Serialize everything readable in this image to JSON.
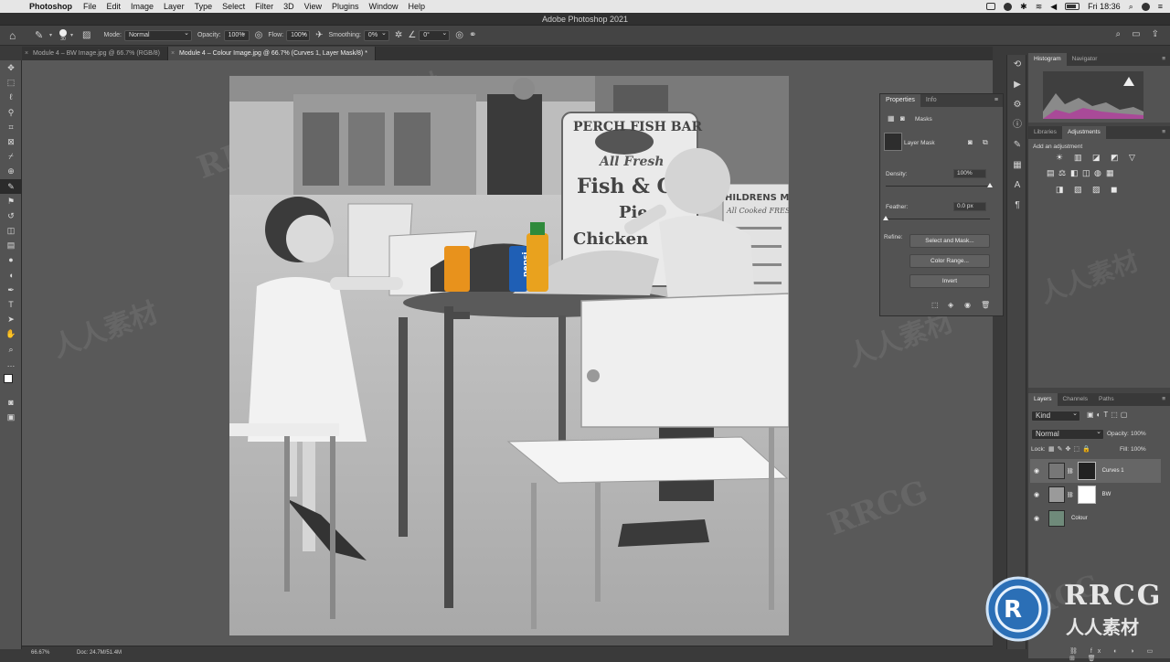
{
  "menubar": {
    "app": "Photoshop",
    "items": [
      "File",
      "Edit",
      "Image",
      "Layer",
      "Type",
      "Select",
      "Filter",
      "3D",
      "View",
      "Plugins",
      "Window",
      "Help"
    ],
    "clock": "Fri 18:36"
  },
  "window_title": "Adobe Photoshop 2021",
  "options": {
    "brush_size": "30",
    "mode_label": "Mode:",
    "mode_value": "Normal",
    "opacity_label": "Opacity:",
    "opacity_value": "100%",
    "flow_label": "Flow:",
    "flow_value": "100%",
    "smoothing_label": "Smoothing:",
    "smoothing_value": "0%",
    "angle_value": "0°"
  },
  "tabs": [
    {
      "label": "Module 4 – BW Image.jpg @ 66.7% (RGB/8)"
    },
    {
      "label": "Module 4 – Colour Image.jpg @ 66.7% (Curves 1, Layer Mask/8) *"
    }
  ],
  "photo_text": {
    "sign_title": "PERCH FISH BAR",
    "sign_line1": "All Fresh",
    "sign_line2": "Fish & Ch",
    "sign_line3": "Pies",
    "sign_line4": "Chicken",
    "menu2_title": "HILDRENS ME",
    "menu2_sub": "All Cooked FRES",
    "can1": "",
    "can2": "pepsi"
  },
  "status": {
    "zoom": "66.67%",
    "doc": "Doc: 24.7M/51.4M"
  },
  "properties": {
    "tab_properties": "Properties",
    "tab_info": "Info",
    "masks_label": "Masks",
    "layer_mask_label": "Layer Mask",
    "density_label": "Density:",
    "density_value": "100%",
    "density_level": 1.0,
    "feather_label": "Feather:",
    "feather_value": "0.0 px",
    "feather_level": 0.0,
    "refine_label": "Refine:",
    "select_mask_btn": "Select and Mask...",
    "color_range_btn": "Color Range...",
    "invert_btn": "Invert"
  },
  "histogram": {
    "tab_histogram": "Histogram",
    "tab_navigator": "Navigator"
  },
  "adjustments": {
    "tab_libraries": "Libraries",
    "tab_adjustments": "Adjustments",
    "add_label": "Add an adjustment"
  },
  "layers": {
    "tab_layers": "Layers",
    "tab_channels": "Channels",
    "tab_paths": "Paths",
    "filter_kind": "Kind",
    "blend_mode": "Normal",
    "opacity_label": "Opacity:",
    "opacity_value": "100%",
    "lock_label": "Lock:",
    "fill_label": "Fill:",
    "fill_value": "100%",
    "items": [
      {
        "name": "Curves 1"
      },
      {
        "name": "BW"
      },
      {
        "name": "Colour"
      }
    ]
  },
  "watermark": {
    "brand": "RRCG",
    "sub": "人人素材"
  },
  "colors": {
    "accent_selected": "#2b2b2b",
    "panel": "#535353",
    "canvas_bg": "#595959"
  }
}
